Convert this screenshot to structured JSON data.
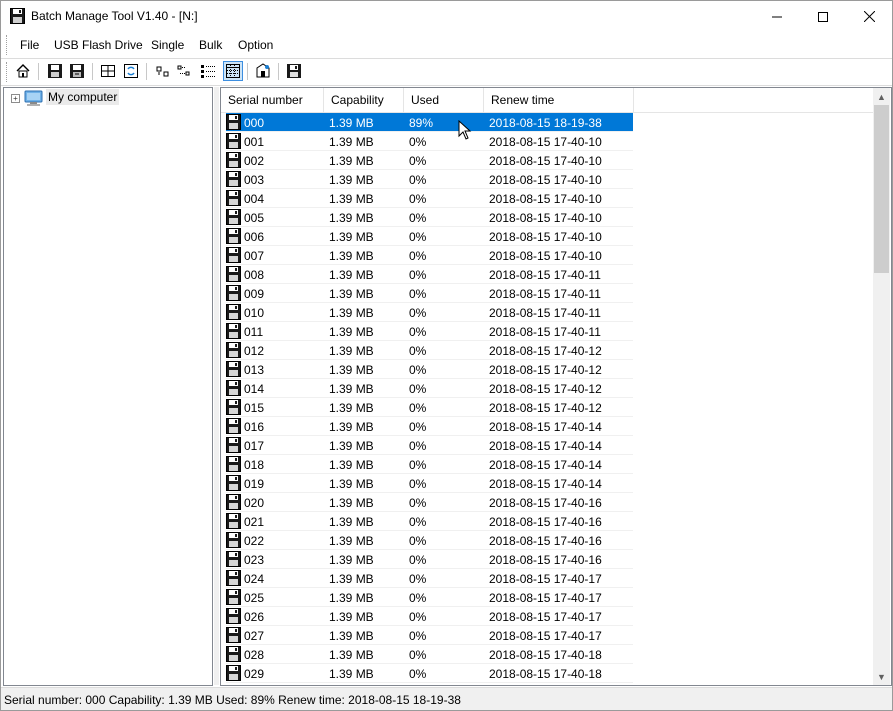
{
  "window": {
    "title": "Batch Manage Tool V1.40  - [N:]",
    "minimize_glyph": "—",
    "maximize_glyph": "☐",
    "close_glyph": "✕"
  },
  "menu": {
    "items": [
      {
        "label": "File"
      },
      {
        "label": "USB Flash Drive"
      },
      {
        "label": "Single"
      },
      {
        "label": "Bulk"
      },
      {
        "label": "Option"
      }
    ]
  },
  "toolbar": {
    "buttons": [
      "home-icon",
      "save-image-icon",
      "load-image-icon",
      "large-icons-view-icon",
      "refresh-icon",
      "small-icons-view-icon",
      "list-view-icon",
      "tree-view-icon",
      "details-view-icon",
      "properties-icon",
      "save-icon"
    ],
    "active_button": "details-view-icon"
  },
  "tree": {
    "root_label": "My computer",
    "expander": "+"
  },
  "list": {
    "columns": [
      "Serial number",
      "Capability",
      "Used",
      "Renew time"
    ],
    "rows": [
      {
        "serial": "000",
        "capability": "1.39 MB",
        "used": "89%",
        "renew": "2018-08-15 18-19-38"
      },
      {
        "serial": "001",
        "capability": "1.39 MB",
        "used": "0%",
        "renew": "2018-08-15 17-40-10"
      },
      {
        "serial": "002",
        "capability": "1.39 MB",
        "used": "0%",
        "renew": "2018-08-15 17-40-10"
      },
      {
        "serial": "003",
        "capability": "1.39 MB",
        "used": "0%",
        "renew": "2018-08-15 17-40-10"
      },
      {
        "serial": "004",
        "capability": "1.39 MB",
        "used": "0%",
        "renew": "2018-08-15 17-40-10"
      },
      {
        "serial": "005",
        "capability": "1.39 MB",
        "used": "0%",
        "renew": "2018-08-15 17-40-10"
      },
      {
        "serial": "006",
        "capability": "1.39 MB",
        "used": "0%",
        "renew": "2018-08-15 17-40-10"
      },
      {
        "serial": "007",
        "capability": "1.39 MB",
        "used": "0%",
        "renew": "2018-08-15 17-40-10"
      },
      {
        "serial": "008",
        "capability": "1.39 MB",
        "used": "0%",
        "renew": "2018-08-15 17-40-11"
      },
      {
        "serial": "009",
        "capability": "1.39 MB",
        "used": "0%",
        "renew": "2018-08-15 17-40-11"
      },
      {
        "serial": "010",
        "capability": "1.39 MB",
        "used": "0%",
        "renew": "2018-08-15 17-40-11"
      },
      {
        "serial": "011",
        "capability": "1.39 MB",
        "used": "0%",
        "renew": "2018-08-15 17-40-11"
      },
      {
        "serial": "012",
        "capability": "1.39 MB",
        "used": "0%",
        "renew": "2018-08-15 17-40-12"
      },
      {
        "serial": "013",
        "capability": "1.39 MB",
        "used": "0%",
        "renew": "2018-08-15 17-40-12"
      },
      {
        "serial": "014",
        "capability": "1.39 MB",
        "used": "0%",
        "renew": "2018-08-15 17-40-12"
      },
      {
        "serial": "015",
        "capability": "1.39 MB",
        "used": "0%",
        "renew": "2018-08-15 17-40-12"
      },
      {
        "serial": "016",
        "capability": "1.39 MB",
        "used": "0%",
        "renew": "2018-08-15 17-40-14"
      },
      {
        "serial": "017",
        "capability": "1.39 MB",
        "used": "0%",
        "renew": "2018-08-15 17-40-14"
      },
      {
        "serial": "018",
        "capability": "1.39 MB",
        "used": "0%",
        "renew": "2018-08-15 17-40-14"
      },
      {
        "serial": "019",
        "capability": "1.39 MB",
        "used": "0%",
        "renew": "2018-08-15 17-40-14"
      },
      {
        "serial": "020",
        "capability": "1.39 MB",
        "used": "0%",
        "renew": "2018-08-15 17-40-16"
      },
      {
        "serial": "021",
        "capability": "1.39 MB",
        "used": "0%",
        "renew": "2018-08-15 17-40-16"
      },
      {
        "serial": "022",
        "capability": "1.39 MB",
        "used": "0%",
        "renew": "2018-08-15 17-40-16"
      },
      {
        "serial": "023",
        "capability": "1.39 MB",
        "used": "0%",
        "renew": "2018-08-15 17-40-16"
      },
      {
        "serial": "024",
        "capability": "1.39 MB",
        "used": "0%",
        "renew": "2018-08-15 17-40-17"
      },
      {
        "serial": "025",
        "capability": "1.39 MB",
        "used": "0%",
        "renew": "2018-08-15 17-40-17"
      },
      {
        "serial": "026",
        "capability": "1.39 MB",
        "used": "0%",
        "renew": "2018-08-15 17-40-17"
      },
      {
        "serial": "027",
        "capability": "1.39 MB",
        "used": "0%",
        "renew": "2018-08-15 17-40-17"
      },
      {
        "serial": "028",
        "capability": "1.39 MB",
        "used": "0%",
        "renew": "2018-08-15 17-40-18"
      },
      {
        "serial": "029",
        "capability": "1.39 MB",
        "used": "0%",
        "renew": "2018-08-15 17-40-18"
      }
    ],
    "selected_index": 0
  },
  "scrollbar": {
    "up_glyph": "▲",
    "down_glyph": "▼"
  },
  "status": {
    "text": "Serial number: 000 Capability: 1.39 MB  Used: 89%  Renew time: 2018-08-15 18-19-38"
  },
  "colors": {
    "selection": "#0078d7",
    "accent_active": "#cce4f7"
  }
}
